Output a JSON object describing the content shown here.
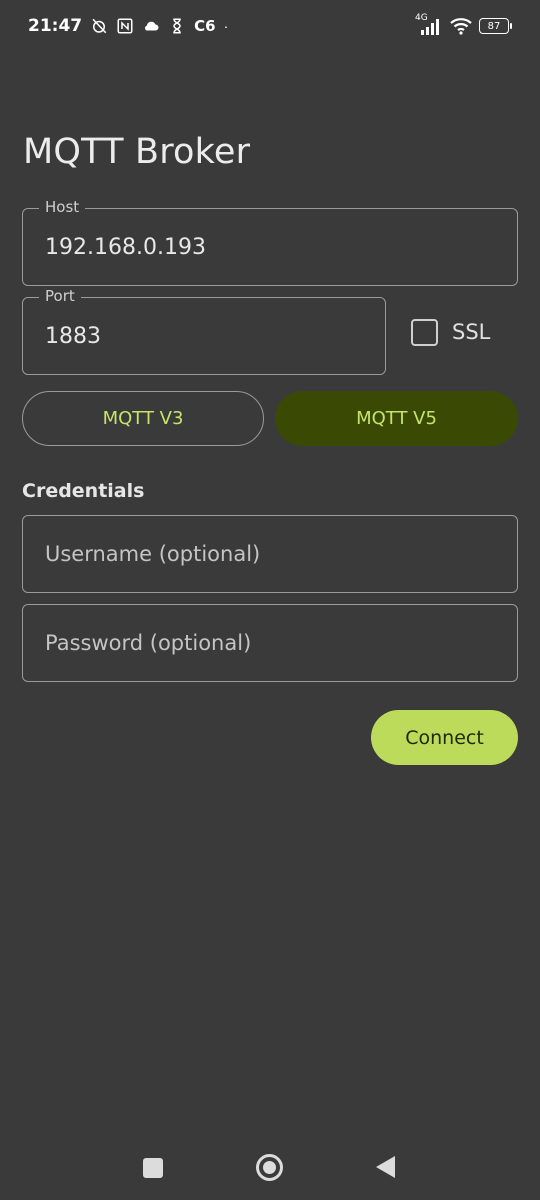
{
  "status_bar": {
    "time": "21:47",
    "carrier": "C6",
    "dot": "·",
    "network": "4G",
    "battery": "87",
    "icons": [
      "alarm-off-icon",
      "nfc-icon",
      "cloud-icon",
      "hourglass-icon",
      "signal-icon",
      "wifi-icon",
      "battery-icon"
    ]
  },
  "page": {
    "title": "MQTT Broker"
  },
  "host": {
    "label": "Host",
    "value": "192.168.0.193"
  },
  "port": {
    "label": "Port",
    "value": "1883"
  },
  "ssl": {
    "label": "SSL",
    "checked": false
  },
  "protocol": {
    "options": [
      "MQTT V3",
      "MQTT V5"
    ],
    "selected": "MQTT V5"
  },
  "credentials": {
    "section_label": "Credentials",
    "username_placeholder": "Username (optional)",
    "password_placeholder": "Password (optional)"
  },
  "actions": {
    "connect_label": "Connect"
  },
  "colors": {
    "background": "#3a3a3a",
    "accent": "#bcdb5a",
    "selected_segment": "#3a4a05",
    "segment_text": "#c6e36a"
  },
  "nav_icons": [
    "recents-icon",
    "home-icon",
    "back-icon"
  ]
}
